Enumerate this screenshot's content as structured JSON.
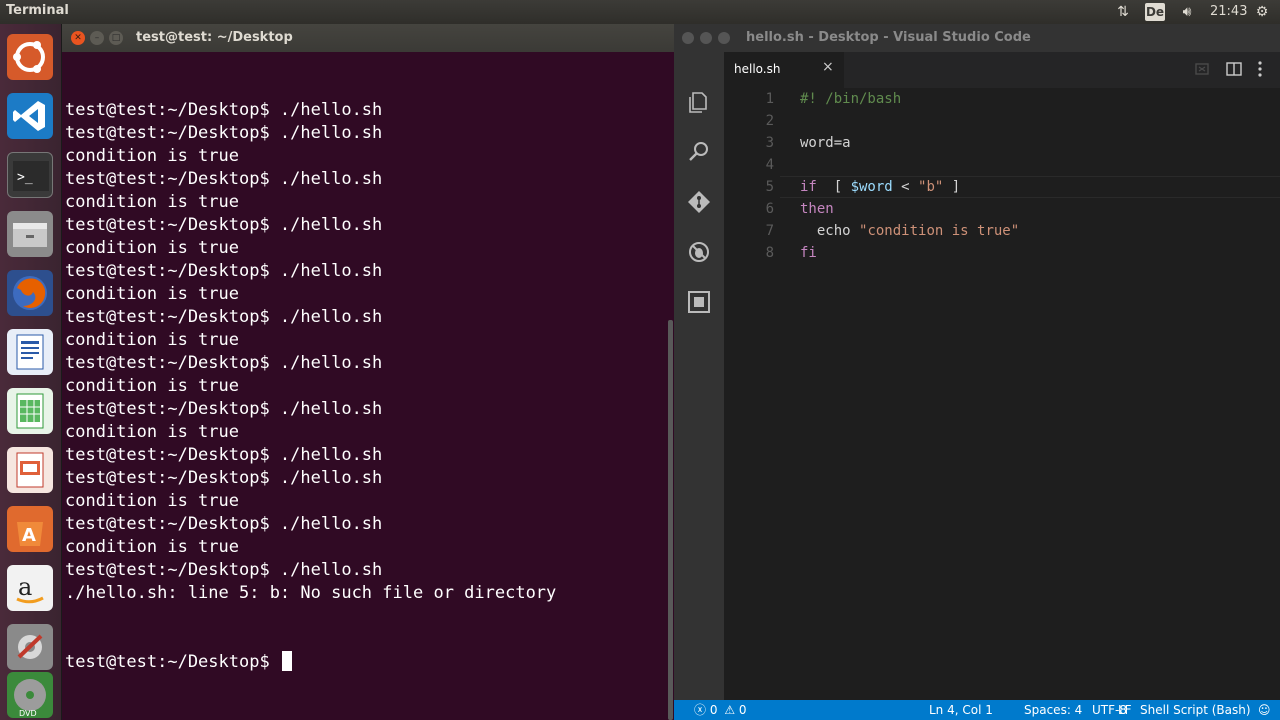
{
  "top_panel": {
    "title": "Terminal",
    "keyboard_layout": "De",
    "clock": "21:43"
  },
  "launcher": {
    "items": [
      "ubuntu-dash",
      "vscode",
      "terminal",
      "files",
      "firefox",
      "writer",
      "calc",
      "impress",
      "software-center",
      "amazon",
      "system-settings",
      "dvd"
    ]
  },
  "terminal": {
    "title": "test@test: ~/Desktop",
    "lines": [
      "test@test:~/Desktop$ ./hello.sh",
      "test@test:~/Desktop$ ./hello.sh",
      "condition is true",
      "test@test:~/Desktop$ ./hello.sh",
      "condition is true",
      "test@test:~/Desktop$ ./hello.sh",
      "condition is true",
      "test@test:~/Desktop$ ./hello.sh",
      "condition is true",
      "test@test:~/Desktop$ ./hello.sh",
      "condition is true",
      "test@test:~/Desktop$ ./hello.sh",
      "condition is true",
      "test@test:~/Desktop$ ./hello.sh",
      "condition is true",
      "test@test:~/Desktop$ ./hello.sh",
      "test@test:~/Desktop$ ./hello.sh",
      "condition is true",
      "test@test:~/Desktop$ ./hello.sh",
      "condition is true",
      "test@test:~/Desktop$ ./hello.sh",
      "./hello.sh: line 5: b: No such file or directory"
    ],
    "prompt": "test@test:~/Desktop$ "
  },
  "vscode": {
    "title": "hello.sh - Desktop - Visual Studio Code",
    "tab_label": "hello.sh",
    "tab_close": "×",
    "code": [
      {
        "n": "1",
        "parts": [
          {
            "t": "#! /bin/bash",
            "c": "c-comment"
          }
        ]
      },
      {
        "n": "2",
        "parts": []
      },
      {
        "n": "3",
        "parts": [
          {
            "t": "word=a",
            "c": "c-op"
          }
        ]
      },
      {
        "n": "4",
        "parts": []
      },
      {
        "n": "5",
        "parts": [
          {
            "t": "if",
            "c": "c-kw"
          },
          {
            "t": "  [ ",
            "c": "c-op"
          },
          {
            "t": "$word",
            "c": "c-var"
          },
          {
            "t": " < ",
            "c": "c-op"
          },
          {
            "t": "\"b\"",
            "c": "c-str"
          },
          {
            "t": " ]",
            "c": "c-op"
          }
        ]
      },
      {
        "n": "6",
        "parts": [
          {
            "t": "then",
            "c": "c-kw"
          }
        ]
      },
      {
        "n": "7",
        "parts": [
          {
            "t": "  echo ",
            "c": "c-op"
          },
          {
            "t": "\"condition is true\"",
            "c": "c-str"
          }
        ]
      },
      {
        "n": "8",
        "parts": [
          {
            "t": "fi",
            "c": "c-kw"
          }
        ]
      }
    ],
    "status": {
      "errors": "0",
      "warnings": "0",
      "position": "Ln 4, Col 1",
      "spaces": "Spaces: 4",
      "encoding": "UTF-8",
      "eol": "LF",
      "language": "Shell Script (Bash)"
    }
  }
}
